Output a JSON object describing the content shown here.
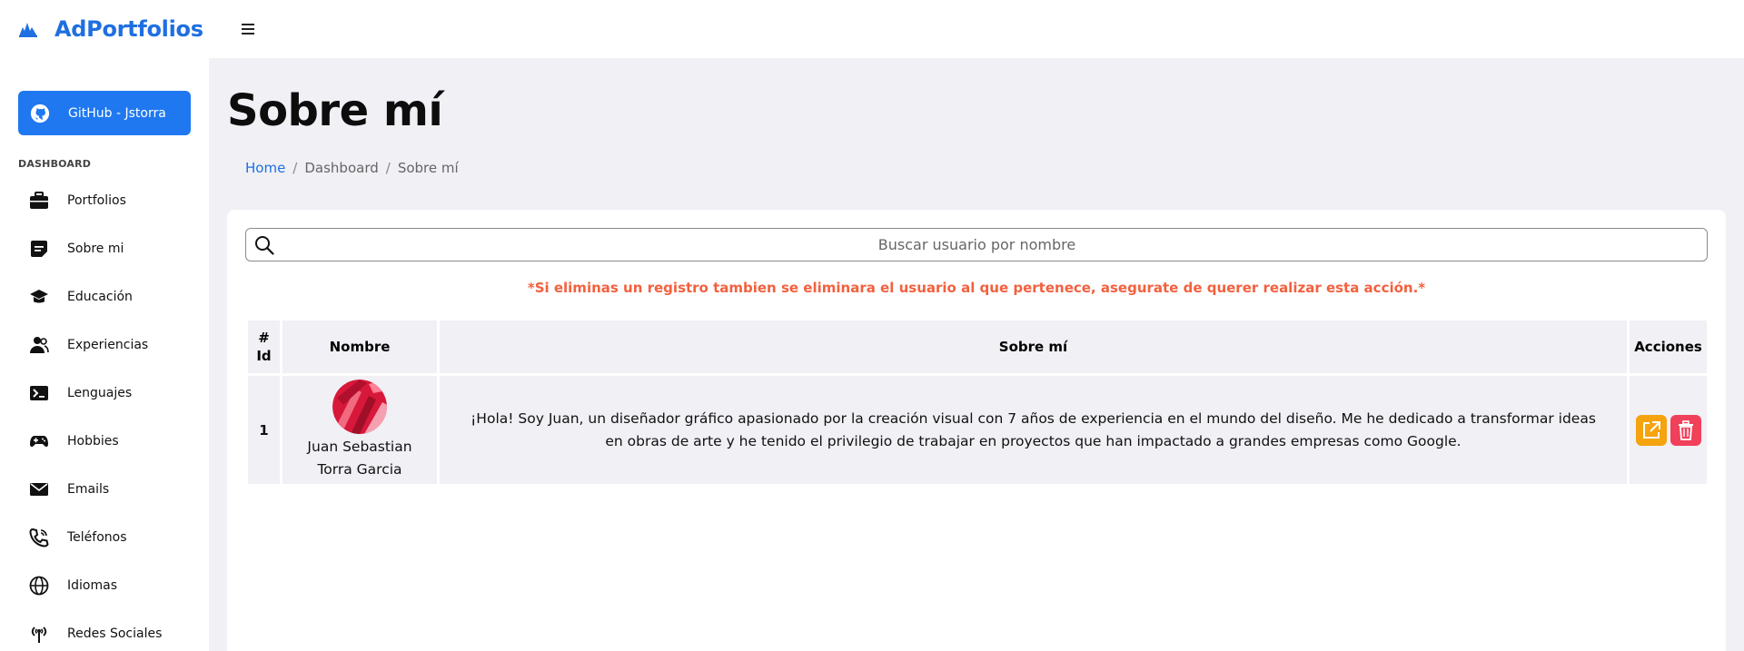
{
  "app": {
    "brand_name": "AdPortfolios"
  },
  "sidebar": {
    "github_label": "GitHub - Jstorra",
    "section_label": "DASHBOARD",
    "items": [
      {
        "label": "Portfolios",
        "icon": "briefcase-icon"
      },
      {
        "label": "Sobre mi",
        "icon": "note-icon"
      },
      {
        "label": "Educación",
        "icon": "graduation-cap-icon"
      },
      {
        "label": "Experiencias",
        "icon": "users-icon"
      },
      {
        "label": "Lenguajes",
        "icon": "terminal-icon"
      },
      {
        "label": "Hobbies",
        "icon": "gamepad-icon"
      },
      {
        "label": "Emails",
        "icon": "envelope-icon"
      },
      {
        "label": "Teléfonos",
        "icon": "phone-icon"
      },
      {
        "label": "Idiomas",
        "icon": "globe-icon"
      },
      {
        "label": "Redes Sociales",
        "icon": "broadcast-icon"
      }
    ]
  },
  "main": {
    "title": "Sobre mí",
    "breadcrumb": [
      "Home",
      "Dashboard",
      "Sobre mí"
    ],
    "search_placeholder": "Buscar usuario por nombre",
    "warning": "*Si eliminas un registro tambien se eliminara el usuario al que pertenece, asegurate de querer realizar esta acción.*",
    "table": {
      "headers": {
        "id_top": "#",
        "id_bottom": "Id",
        "name": "Nombre",
        "about": "Sobre mí",
        "actions": "Acciones"
      },
      "rows": [
        {
          "id": "1",
          "name_line1": "Juan Sebastian",
          "name_line2": "Torra Garcia",
          "about_line1": "¡Hola! Soy Juan, un diseñador gráfico apasionado por la creación visual con 7 años de experiencia en el mundo del diseño. Me he dedicado a transformar ideas",
          "about_line2": "en obras de arte y he tenido el privilegio de trabajar en proyectos que han impactado a grandes empresas como Google."
        }
      ]
    }
  },
  "colors": {
    "brand": "#1f6fe0",
    "github_button": "#1f78f0",
    "warning": "#f2613f",
    "edit": "#f5a30f",
    "delete": "#f0405a",
    "background": "#f0f0f5"
  }
}
